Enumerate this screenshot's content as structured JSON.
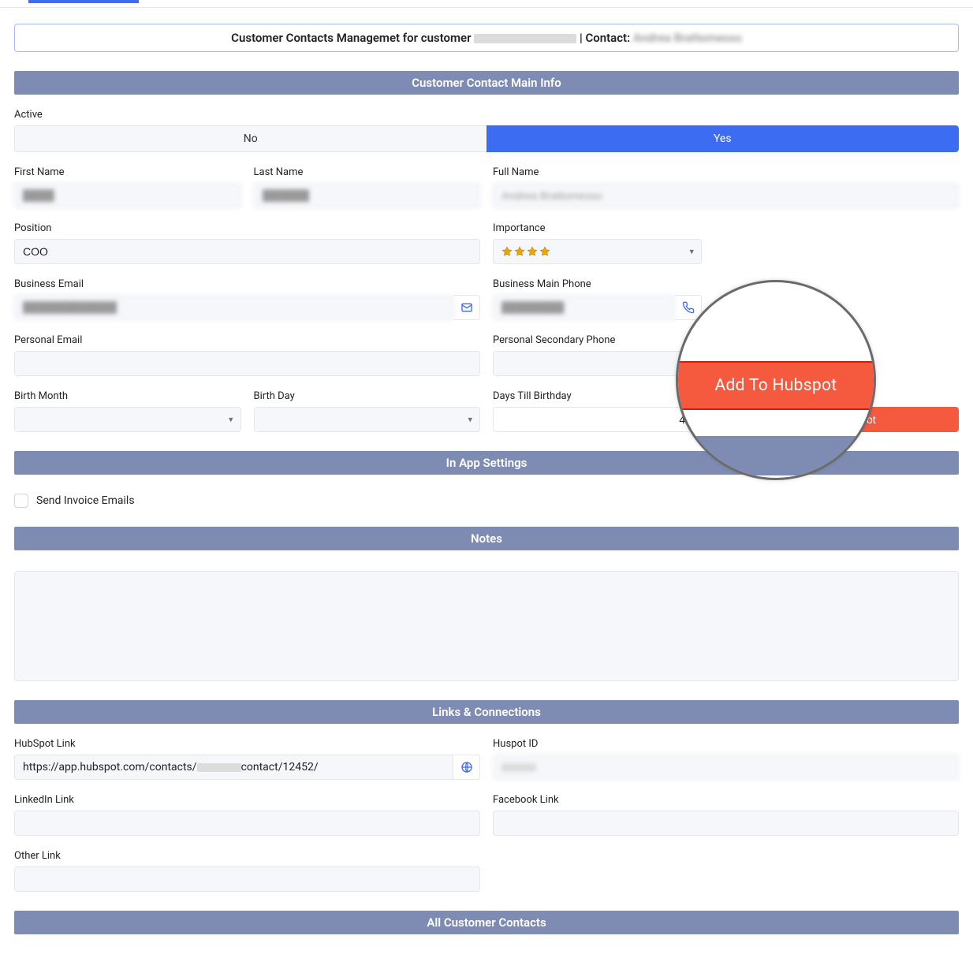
{
  "title": {
    "prefix": "Customer Contacts Managemet for customer",
    "contact_label": "| Contact:",
    "customer_name": "████████████",
    "contact_name": "Andrea Brattomesso"
  },
  "sections": {
    "main_info": "Customer Contact Main Info",
    "in_app": "In App Settings",
    "notes": "Notes",
    "links": "Links & Connections",
    "all_contacts": "All Customer Contacts"
  },
  "labels": {
    "active": "Active",
    "first_name": "First Name",
    "last_name": "Last Name",
    "full_name": "Full Name",
    "position": "Position",
    "importance": "Importance",
    "business_email": "Business Email",
    "business_phone": "Business Main Phone",
    "personal_email": "Personal Email",
    "personal_phone": "Personal Secondary Phone",
    "birth_month": "Birth Month",
    "birth_day": "Birth Day",
    "days_till": "Days Till Birthday",
    "send_invoice": "Send Invoice Emails",
    "hubspot_link": "HubSpot Link",
    "hubspot_id": "Huspot ID",
    "linkedin": "LinkedIn Link",
    "facebook": "Facebook Link",
    "other_link": "Other Link"
  },
  "toggle": {
    "no": "No",
    "yes": "Yes",
    "active_value": "Yes"
  },
  "fields": {
    "first_name": "████",
    "last_name": "██████",
    "full_name": "Andrea Brattomesso",
    "position": "COO",
    "importance_stars": 4,
    "business_email": "████████████",
    "business_phone": "████████",
    "personal_email": "",
    "personal_phone": "",
    "birth_month": "",
    "birth_day": "",
    "days_till": "49",
    "send_invoice_checked": false,
    "notes": "",
    "hubspot_link_prefix": "https://app.hubspot.com/contacts/",
    "hubspot_link_mid": "██████",
    "hubspot_link_suffix": "contact/12452/",
    "hubspot_id": "█████",
    "linkedin": "",
    "facebook": "",
    "other_link": ""
  },
  "buttons": {
    "add_hubspot": "Add To Hubspot"
  }
}
